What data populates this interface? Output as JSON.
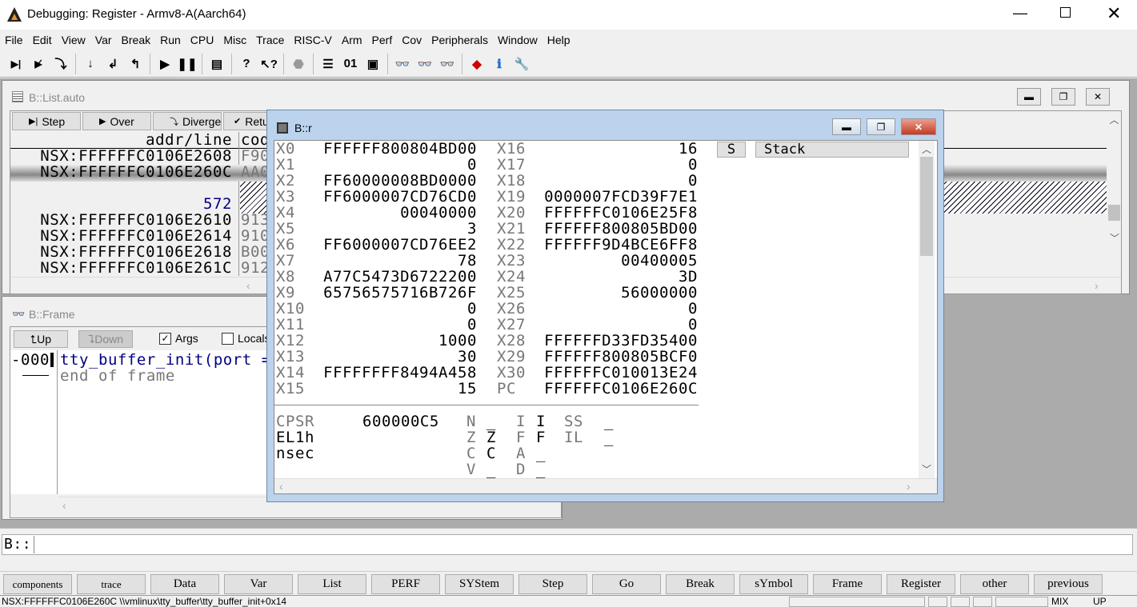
{
  "app": {
    "title": "Debugging: Register - Armv8-A(Aarch64)"
  },
  "menu": [
    "File",
    "Edit",
    "View",
    "Var",
    "Break",
    "Run",
    "CPU",
    "Misc",
    "Trace",
    "RISC-V",
    "Arm",
    "Perf",
    "Cov",
    "Peripherals",
    "Window",
    "Help"
  ],
  "toolbar": [
    "step-icon",
    "step-over-icon",
    "diverge-icon",
    "step-down-icon",
    "return-icon",
    "up-icon",
    "go-icon",
    "break-icon",
    "source-mode-icon",
    "help-icon",
    "context-help-icon",
    "stop-icon",
    "list-icon",
    "dump-icon",
    "register-icon",
    "frame-add-icon",
    "frame-icon",
    "frame-list-icon",
    "cube-icon",
    "info-icon",
    "wrench-icon"
  ],
  "list_window": {
    "title": "B::List.auto",
    "buttons": [
      "Step",
      "Over",
      "Diverge",
      "Retu"
    ],
    "col_addr": "addr/line",
    "col_code": "cod",
    "rows": [
      {
        "addr": "NSX:FFFFFFC0106E2608",
        "code": "F90"
      },
      {
        "addr": "NSX:FFFFFFC0106E260C",
        "code": "AA0"
      },
      {
        "addr": "",
        "code": ""
      },
      {
        "addr": "572",
        "code": ""
      },
      {
        "addr": "NSX:FFFFFFC0106E2610",
        "code": "913"
      },
      {
        "addr": "NSX:FFFFFFC0106E2614",
        "code": "910"
      },
      {
        "addr": "NSX:FFFFFFC0106E2618",
        "code": "B00"
      },
      {
        "addr": "NSX:FFFFFFC0106E261C",
        "code": "912"
      }
    ]
  },
  "frame_window": {
    "title": "B::Frame",
    "up": "Up",
    "down": "Down",
    "args": "Args",
    "locals": "Locals",
    "args_checked": true,
    "locals_checked": false,
    "level": "-000",
    "call": "tty_buffer_init(port =",
    "end": "end of frame"
  },
  "reg_window": {
    "title": "B::r",
    "left": [
      [
        "X0",
        "FFFFFF800804BD00"
      ],
      [
        "X1",
        "0"
      ],
      [
        "X2",
        "FF60000008BD0000"
      ],
      [
        "X3",
        "FF6000007CD76CD0"
      ],
      [
        "X4",
        "00040000"
      ],
      [
        "X5",
        "3"
      ],
      [
        "X6",
        "FF6000007CD76EE2"
      ],
      [
        "X7",
        "78"
      ],
      [
        "X8",
        "A77C5473D6722200"
      ],
      [
        "X9",
        "65756575716B726F"
      ],
      [
        "X10",
        "0"
      ],
      [
        "X11",
        "0"
      ],
      [
        "X12",
        "1000"
      ],
      [
        "X13",
        "30"
      ],
      [
        "X14",
        "FFFFFFFF8494A458"
      ],
      [
        "X15",
        "15"
      ]
    ],
    "right": [
      [
        "X16",
        "16"
      ],
      [
        "X17",
        "0"
      ],
      [
        "X18",
        "0"
      ],
      [
        "X19",
        "0000007FCD39F7E1"
      ],
      [
        "X20",
        "FFFFFFC0106E25F8"
      ],
      [
        "X21",
        "FFFFFF800805BD00"
      ],
      [
        "X22",
        "FFFFFF9D4BCE6FF8"
      ],
      [
        "X23",
        "00400005"
      ],
      [
        "X24",
        "3D"
      ],
      [
        "X25",
        "56000000"
      ],
      [
        "X26",
        "0"
      ],
      [
        "X27",
        "0"
      ],
      [
        "X28",
        "FFFFFFD33FD35400"
      ],
      [
        "X29",
        "FFFFFF800805BCF0"
      ],
      [
        "X30",
        "FFFFFFC010013E24"
      ],
      [
        "PC",
        "FFFFFFC0106E260C"
      ]
    ],
    "cpsr_label": "CPSR",
    "cpsr_value": "600000C5",
    "mode": "EL1h",
    "security": "nsec",
    "flags": [
      [
        "N",
        "_"
      ],
      [
        "Z",
        "Z"
      ],
      [
        "C",
        "C"
      ],
      [
        "V",
        "_"
      ]
    ],
    "flags2": [
      [
        "I",
        "I"
      ],
      [
        "F",
        "F"
      ],
      [
        "A",
        "_"
      ],
      [
        "D",
        "_"
      ]
    ],
    "flags3": [
      [
        "SS",
        "_"
      ],
      [
        "IL",
        "_"
      ]
    ],
    "s_button": "S",
    "stack_button": "Stack"
  },
  "command": {
    "prompt": "B::",
    "value": ""
  },
  "buttons": [
    "components",
    "trace",
    "Data",
    "Var",
    "List",
    "PERF",
    "SYStem",
    "Step",
    "Go",
    "Break",
    "sYmbol",
    "Frame",
    "Register",
    "other",
    "previous"
  ],
  "status": {
    "text": "NSX:FFFFFFC0106E260C \\\\vmlinux\\tty_buffer\\tty_buffer_init+0x14",
    "mode": "MIX",
    "mode2": "UP"
  }
}
